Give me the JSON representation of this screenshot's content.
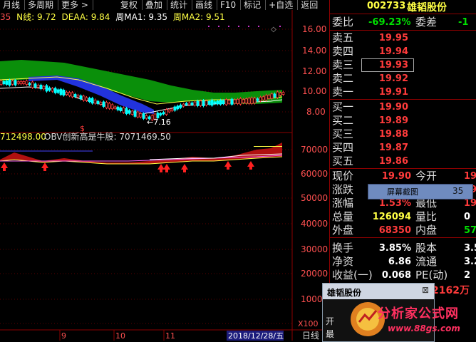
{
  "toolbar": {
    "items": [
      "月线",
      "多周期",
      "更多 >",
      "复权",
      "叠加",
      "统计",
      "画线",
      "F10",
      "标记",
      "+自选",
      "返回"
    ]
  },
  "indicator": {
    "prefix": "35",
    "n_label": "N线: 9.72",
    "deaa_label": "DEAA: 9.84",
    "ma1_label": "周MA1: 9.35",
    "ma2_label": "周MA2: 9.51"
  },
  "price_axis": [
    "16.00",
    "14.00",
    "12.00",
    "10.00",
    "8.00"
  ],
  "low_marker": "7.16",
  "dollar_marker": "$",
  "obv": {
    "prefix": "712498.00",
    "label": "OBV创新高是牛股: 7071469.50",
    "axis": [
      "70000",
      "60000",
      "50000",
      "40000",
      "30000",
      "20000",
      "10000"
    ],
    "unit": "X100"
  },
  "time_axis": [
    "9",
    "10",
    "11"
  ],
  "date_label": "2018/12/28/五",
  "bottom_label": "日线",
  "quote": {
    "code": "002733",
    "name": "雄韬股份",
    "weibi_label": "委比",
    "weibi_value": "-69.23%",
    "weicha_label": "委差",
    "weicha_value": "-1",
    "sell": [
      {
        "label": "卖五",
        "price": "19.95"
      },
      {
        "label": "卖四",
        "price": "19.94"
      },
      {
        "label": "卖三",
        "price": "19.93"
      },
      {
        "label": "卖二",
        "price": "19.92"
      },
      {
        "label": "卖一",
        "price": "19.91"
      }
    ],
    "buy": [
      {
        "label": "买一",
        "price": "19.90"
      },
      {
        "label": "买二",
        "price": "19.89"
      },
      {
        "label": "买三",
        "price": "19.88"
      },
      {
        "label": "买四",
        "price": "19.87"
      },
      {
        "label": "买五",
        "price": "19.86"
      }
    ],
    "stats": [
      {
        "label": "现价",
        "value": "19.90",
        "label2": "今开",
        "value2": "19"
      },
      {
        "label": "涨跌",
        "value": "",
        "label2": "最高",
        "value2": "19"
      },
      {
        "label": "涨幅",
        "value": "1.53%",
        "label2": "最低",
        "value2": "19"
      },
      {
        "label": "总量",
        "value": "126094",
        "label2": "量比",
        "value2": "0"
      },
      {
        "label": "外盘",
        "value": "68350",
        "label2": "内盘",
        "value2": "57"
      },
      {
        "label": "换手",
        "value": "3.85%",
        "label2": "股本",
        "value2": "3.5"
      },
      {
        "label": "净资",
        "value": "6.86",
        "label2": "流通",
        "value2": "3.2"
      },
      {
        "label": "收益(一)",
        "value": "0.068",
        "label2": "PE(动)",
        "value2": "2"
      }
    ],
    "amount": "2162万"
  },
  "popup": {
    "text": "屏幕截图",
    "num": "35"
  },
  "dialog": {
    "title": "雄韬股份",
    "close": "⊠",
    "side_text": [
      "开",
      "最"
    ]
  },
  "watermark": {
    "line1": "分析家公式网",
    "line2": "www.88gs.com"
  },
  "colors": {
    "up": "#ff3b3b",
    "down": "#00ffff",
    "yellow": "#ffff44",
    "green_band": "#0a8f0a",
    "blue_band": "#2233dd",
    "grid": "#8c0000",
    "panel_green": "#00e000"
  }
}
